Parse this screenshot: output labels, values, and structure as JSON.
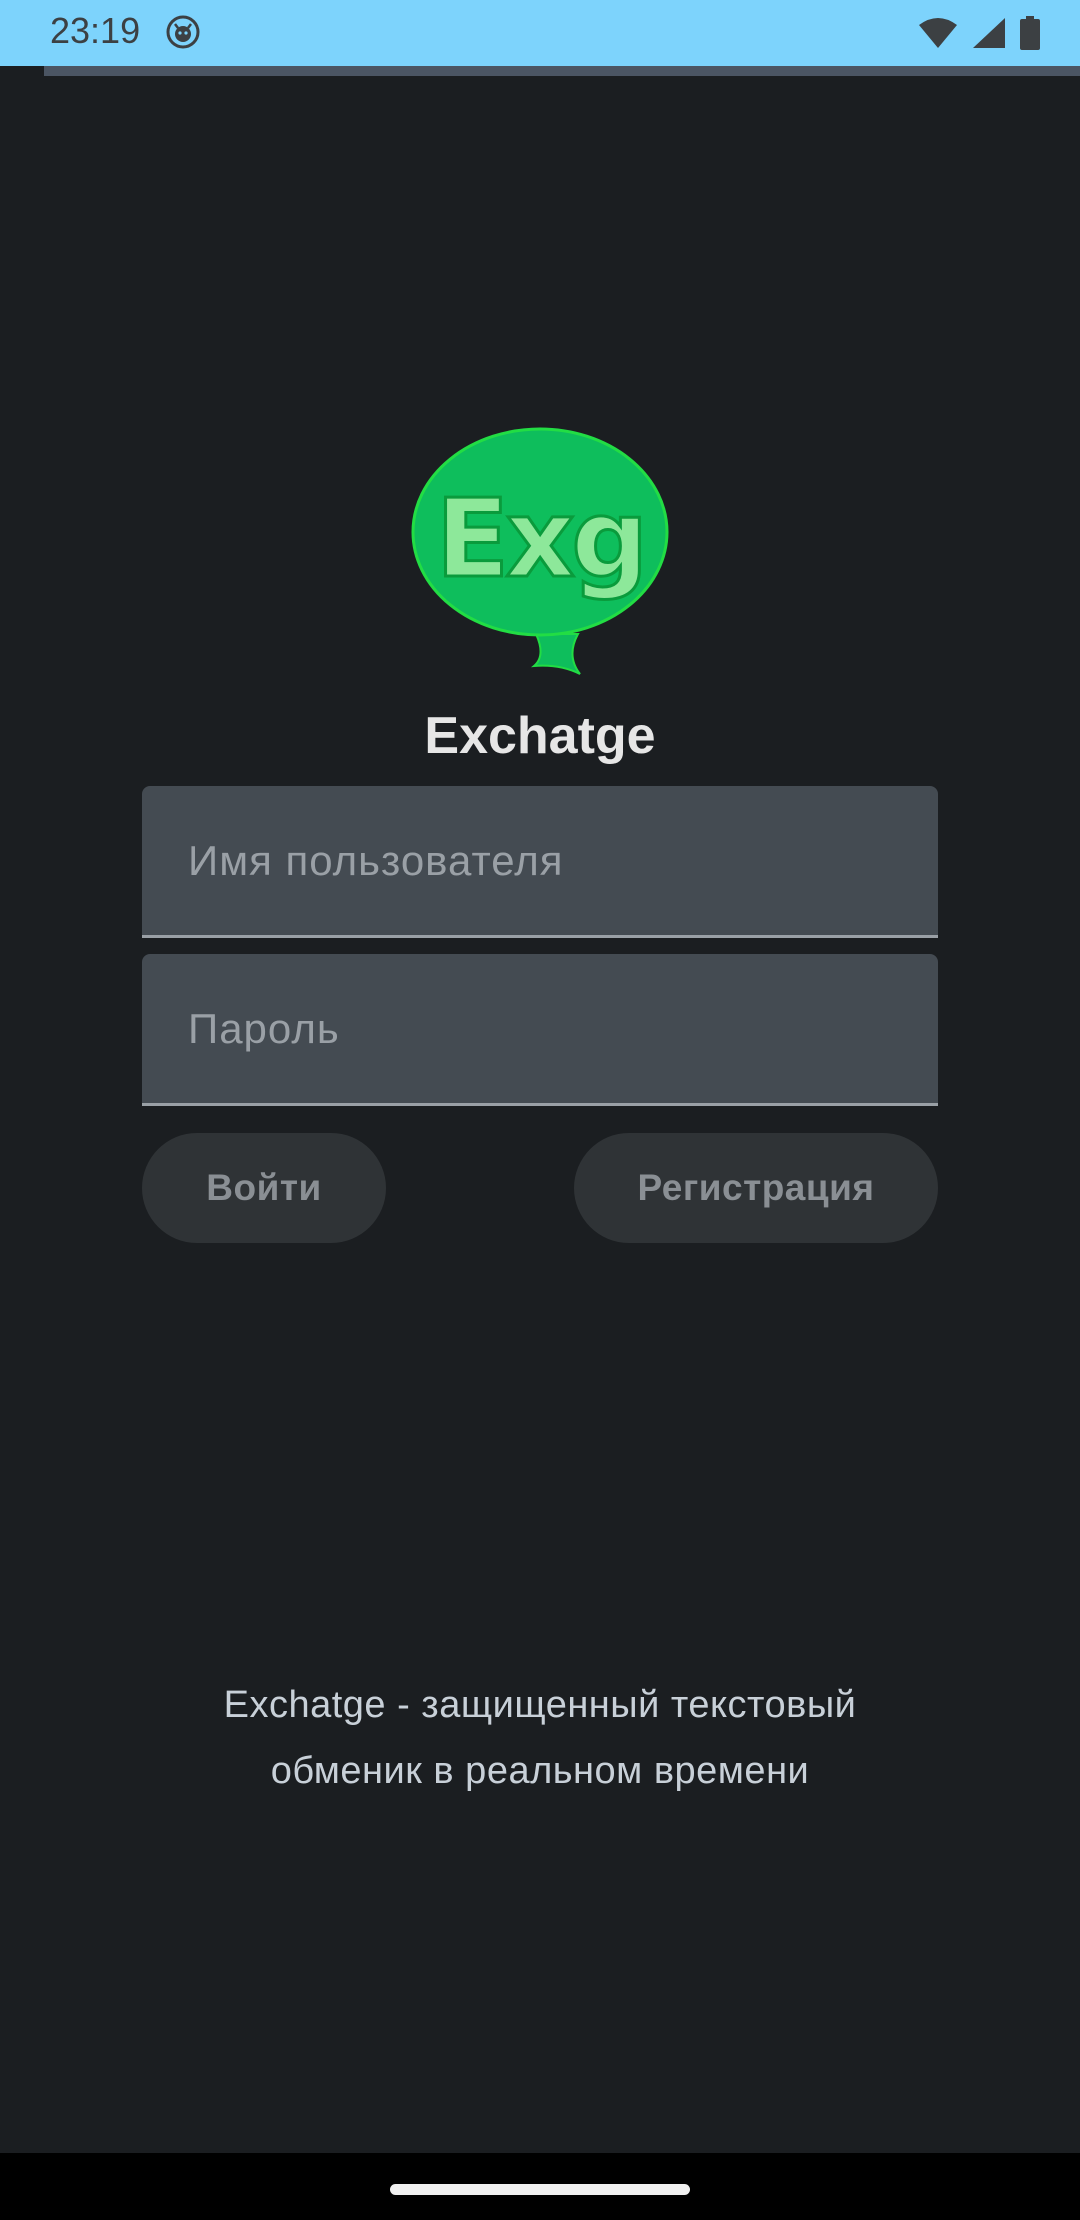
{
  "status_bar": {
    "time": "23:19",
    "icons": [
      "app-notification-icon",
      "wifi-icon",
      "cellular-signal-icon",
      "battery-icon"
    ]
  },
  "logo": {
    "text": "Exg",
    "bubble_color": "#0ebe5c",
    "text_color": "#8de89a"
  },
  "app": {
    "name": "Exchatge"
  },
  "form": {
    "username_placeholder": "Имя пользователя",
    "username_value": "",
    "password_placeholder": "Пароль",
    "password_value": ""
  },
  "buttons": {
    "login_label": "Войти",
    "register_label": "Регистрация"
  },
  "tagline": {
    "line1": "Exchatge - защищенный текстовый",
    "line2": "обменик в реальном времени"
  },
  "colors": {
    "background": "#1b1e21",
    "status_bar": "#7dd3fc",
    "field": "#444b52",
    "button": "#2f3336"
  }
}
